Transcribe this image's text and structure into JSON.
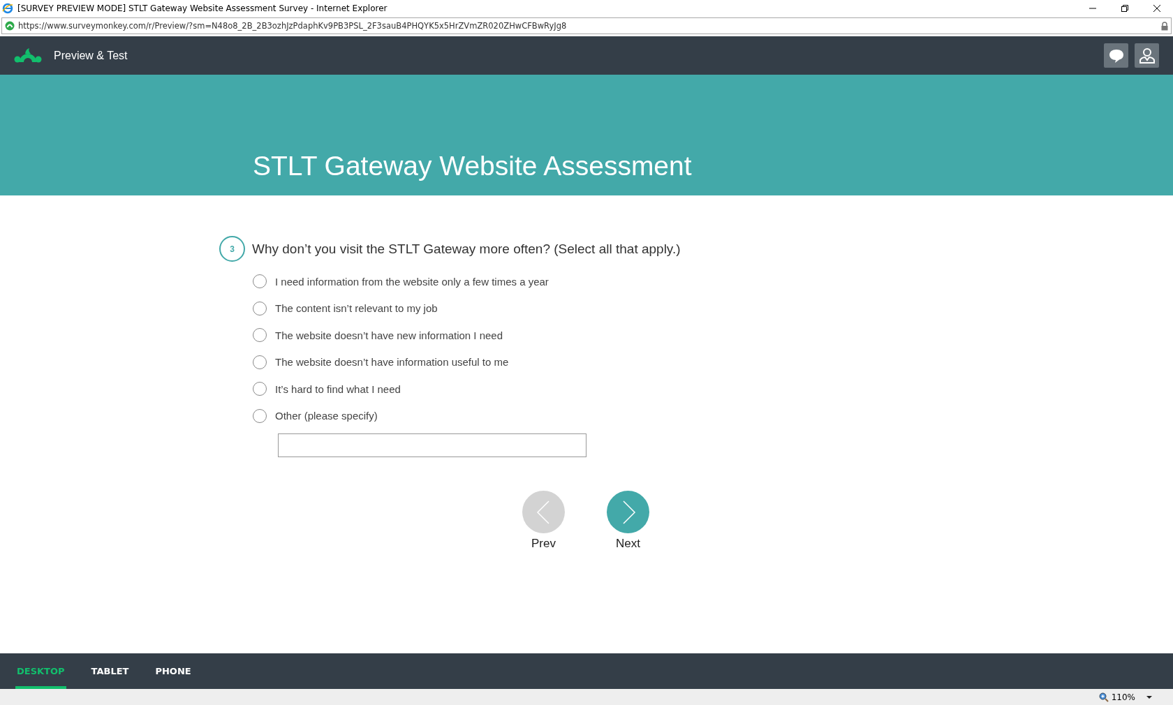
{
  "window": {
    "title": "[SURVEY PREVIEW MODE] STLT Gateway Website Assessment Survey - Internet Explorer"
  },
  "address_bar": {
    "url": "https://www.surveymonkey.com/r/Preview/?sm=N48o8_2B_2B3ozhJzPdaphKv9PB3PSL_2F3sauB4PHQYK5x5HrZVmZR020ZHwCFBwRyJg8"
  },
  "header": {
    "title": "Preview & Test"
  },
  "banner": {
    "title": "STLT Gateway Website Assessment"
  },
  "question": {
    "number": "3",
    "text": "Why don’t you visit the STLT Gateway more often? (Select all that apply.)",
    "options": [
      {
        "label": "I need information from the website only a few times a year",
        "selected": false
      },
      {
        "label": "The content isn’t relevant to my job",
        "selected": false
      },
      {
        "label": "The website doesn’t have new information I need",
        "selected": false
      },
      {
        "label": "The website doesn’t have information useful to me",
        "selected": false
      },
      {
        "label": "It’s hard to find what I need",
        "selected": false
      },
      {
        "label": "Other (please specify)",
        "selected": false
      }
    ]
  },
  "navigation": [
    {
      "label": "Prev",
      "disabled": true
    },
    {
      "label": "Next",
      "disabled": false
    }
  ],
  "device_tabs": [
    {
      "label": "DESKTOP",
      "selected": true
    },
    {
      "label": "TABLET",
      "selected": false
    },
    {
      "label": "PHONE",
      "selected": false
    }
  ],
  "status_bar": {
    "zoom": "110%"
  }
}
